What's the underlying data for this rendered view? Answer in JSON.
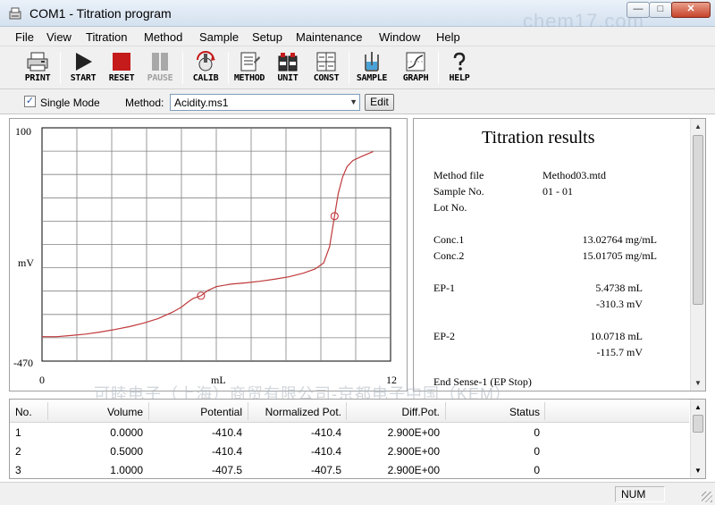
{
  "window": {
    "title": "COM1 - Titration program",
    "watermark": "chem17.com",
    "minimize_glyph": "—",
    "maximize_glyph": "□",
    "close_glyph": "✕"
  },
  "menu": [
    "File",
    "View",
    "Titration",
    "Method",
    "Sample",
    "Setup",
    "Maintenance",
    "Window",
    "Help"
  ],
  "toolbar": {
    "print": "PRINT",
    "start": "START",
    "reset": "RESET",
    "pause": "PAUSE",
    "calib": "CALIB",
    "method": "METHOD",
    "unit": "UNIT",
    "const": "CONST",
    "sample": "SAMPLE",
    "graph": "GRAPH",
    "help": "HELP",
    "icons": [
      "printer-icon",
      "play-icon",
      "stop-square-icon",
      "pause-icon",
      "electrode-icon",
      "document-icon",
      "bottles-icon",
      "calculator-icon",
      "beaker-icon",
      "chart-icon",
      "question-icon"
    ]
  },
  "mode": {
    "single_mode_label": "Single Mode",
    "single_mode_checked": true,
    "check_glyph": "✓",
    "method_label": "Method:",
    "method_value": "Acidity.ms1",
    "dropdown_glyph": "▼",
    "edit_label": "Edit"
  },
  "chart_data": {
    "type": "line",
    "ylabel": "mV",
    "xlabel": "mL",
    "y_top_label": "100",
    "y_bottom_label": "-470",
    "x_left_label": "0",
    "x_right_label": "12",
    "xlim": [
      0,
      12
    ],
    "ylim": [
      -470,
      100
    ],
    "grid": true,
    "line_color": "#c0393b",
    "x": [
      0.0,
      0.5,
      1.0,
      1.5,
      2.0,
      2.5,
      3.0,
      3.5,
      4.0,
      4.5,
      4.8,
      5.0,
      5.2,
      5.4738,
      5.7,
      6.0,
      6.5,
      7.0,
      7.5,
      8.0,
      8.5,
      9.0,
      9.4,
      9.7,
      9.9,
      10.0718,
      10.2,
      10.35,
      10.5,
      10.7,
      11.0,
      11.4
    ],
    "y": [
      -410.4,
      -410.4,
      -407.5,
      -404,
      -399,
      -393,
      -386,
      -377,
      -366,
      -350,
      -338,
      -327,
      -317,
      -310.3,
      -298,
      -288,
      -282,
      -279,
      -275,
      -270,
      -264,
      -255,
      -245,
      -230,
      -190,
      -115.7,
      -60,
      -20,
      5,
      20,
      30,
      42
    ],
    "endpoints": [
      {
        "x": 5.4738,
        "y": -310.3
      },
      {
        "x": 10.0718,
        "y": -115.7
      }
    ]
  },
  "results": {
    "title": "Titration results",
    "rows": [
      {
        "label": "Method file",
        "value": "Method03.mtd"
      },
      {
        "label": "Sample No.",
        "value": "01 - 01"
      },
      {
        "label": "Lot No.",
        "value": ""
      }
    ],
    "conc1_label": "Conc.1",
    "conc1_value": "13.02764 mg/mL",
    "conc2_label": "Conc.2",
    "conc2_value": "15.01705 mg/mL",
    "ep1_label": "EP-1",
    "ep1_ml": "5.4738 mL",
    "ep1_mv": "-310.3 mV",
    "ep2_label": "EP-2",
    "ep2_ml": "10.0718 mL",
    "ep2_mv": "-115.7 mV",
    "end_sense": "End Sense-1 (EP Stop)",
    "scroll_up_glyph": "▲",
    "scroll_down_glyph": "▼"
  },
  "overlay_watermark": "可睦电子（上海）商贸有限公司-京都电子中国（KEM）",
  "table": {
    "columns": [
      "No.",
      "Volume",
      "Potential",
      "Normalized Pot.",
      "Diff.Pot.",
      "Status"
    ],
    "rows": [
      [
        "1",
        "0.0000",
        "-410.4",
        "-410.4",
        "2.900E+00",
        "0"
      ],
      [
        "2",
        "0.5000",
        "-410.4",
        "-410.4",
        "2.900E+00",
        "0"
      ],
      [
        "3",
        "1.0000",
        "-407.5",
        "-407.5",
        "2.900E+00",
        "0"
      ]
    ],
    "scroll_up_glyph": "▲",
    "scroll_down_glyph": "▼"
  },
  "status": {
    "num": "NUM"
  }
}
